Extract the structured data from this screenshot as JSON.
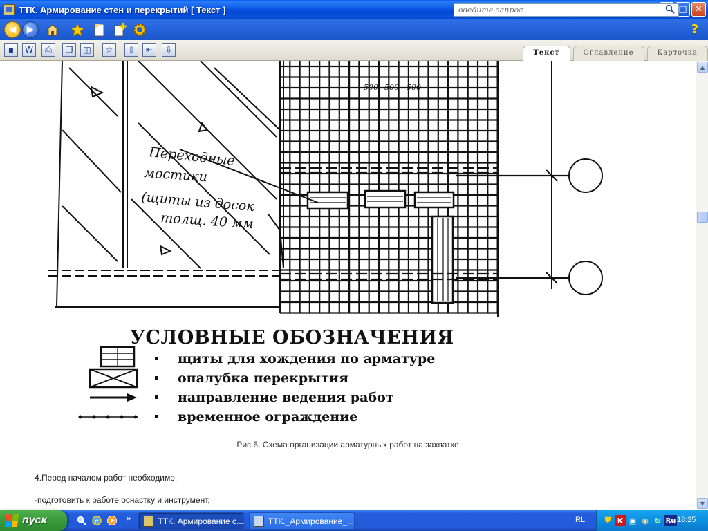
{
  "window": {
    "title": "ТТК. Армирование стен и перекрытий [ Текст ]",
    "minimize": "_",
    "maximize": "□",
    "close": "✕"
  },
  "toolbar": {
    "search_placeholder": "введите запрос",
    "help": "?"
  },
  "tabs": [
    {
      "label": "Текст",
      "active": true
    },
    {
      "label": "Оглавление",
      "active": false
    },
    {
      "label": "Карточка",
      "active": false
    }
  ],
  "drawing": {
    "handwritten_label": [
      "Переходные",
      "мостики",
      "(щиты из досок",
      "толщ. 40 мм"
    ],
    "dimensions": [
      "500",
      "500",
      "500"
    ]
  },
  "legend": {
    "title": "УСЛОВНЫЕ ОБОЗНАЧЕНИЯ",
    "items": [
      {
        "bullet": "-",
        "text": "щиты для хождения по арматуре",
        "symbol": "planks"
      },
      {
        "bullet": "-",
        "text": "опалубка перекрытия",
        "symbol": "crossed-box"
      },
      {
        "bullet": "-",
        "text": "направление ведения работ",
        "symbol": "arrow"
      },
      {
        "bullet": "-",
        "text": "временное ограждение",
        "symbol": "dotted-line"
      }
    ]
  },
  "caption": "Рис.6. Схема организации арматурных работ на захватке",
  "paragraphs": [
    "4.Перед началом работ необходимо:",
    "-подготовить к работе оснастку и инструмент,"
  ],
  "taskbar": {
    "start_label": "пуск",
    "more": "»",
    "buttons": [
      {
        "label": "ТТК. Армирование с...",
        "active": true
      },
      {
        "label": "ТТК._Армирование_...",
        "active": false
      }
    ],
    "language": "RL",
    "tray_ru": "Ru",
    "clock": "18:25"
  }
}
